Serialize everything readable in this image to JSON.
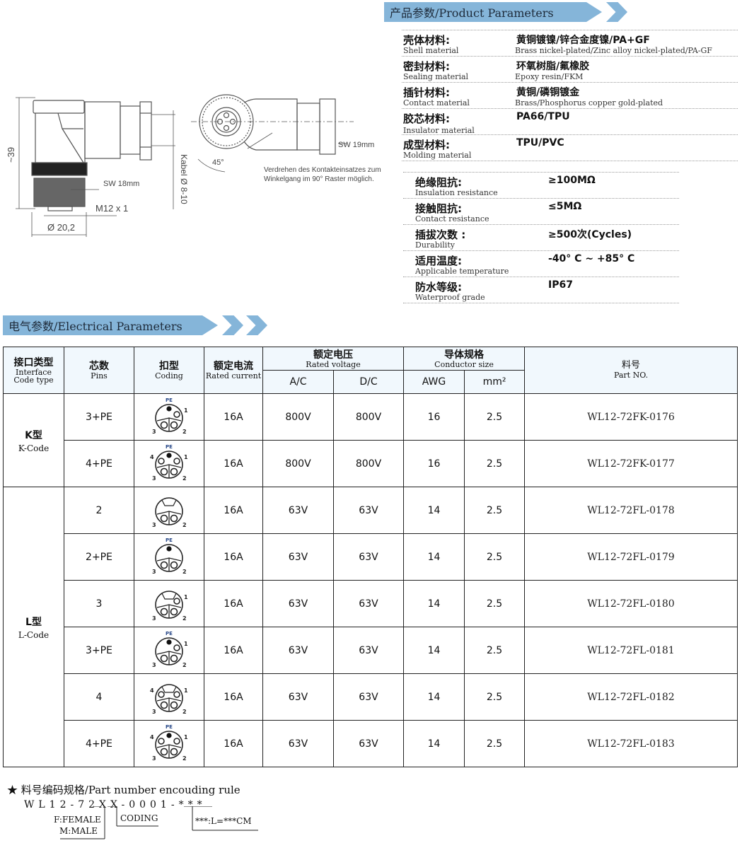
{
  "product_section": {
    "title": "产品参数/Product Parameters",
    "materials": [
      {
        "label_cn": "壳体材料:",
        "label_en": "Shell material",
        "value_cn": "黄铜镀镍/锌合金度镍/PA+GF",
        "value_en": "Brass nickel-plated/Zinc alloy nickel-plated/PA-GF"
      },
      {
        "label_cn": "密封材料:",
        "label_en": "Sealing material",
        "value_cn": "环氧树脂/氟橡胶",
        "value_en": "Epoxy resin/FKM"
      },
      {
        "label_cn": "插针材料:",
        "label_en": "Contact material",
        "value_cn": "黄铜/磷铜镀金",
        "value_en": "Brass/Phosphorus copper gold-plated"
      },
      {
        "label_cn": "胶芯材料:",
        "label_en": "Insulator material",
        "value_cn": "PA66/TPU",
        "value_en": ""
      },
      {
        "label_cn": "成型材料:",
        "label_en": "Molding material",
        "value_cn": "TPU/PVC",
        "value_en": ""
      }
    ],
    "specs": [
      {
        "label_cn": "绝缘阻抗:",
        "label_en": "Insulation resistance",
        "value": "≥100MΩ"
      },
      {
        "label_cn": "接触阻抗:",
        "label_en": "Contact resistance",
        "value": "≤5MΩ"
      },
      {
        "label_cn": "插拔次数 :",
        "label_en": "Durability",
        "value": "≥500次(Cycles)"
      },
      {
        "label_cn": "适用温度:",
        "label_en": "Applicable temperature",
        "value": "-40° C ~ +85° C"
      },
      {
        "label_cn": "防水等级:",
        "label_en": "Waterproof grade",
        "value": "IP67"
      }
    ]
  },
  "drawing": {
    "dim_height": "~39",
    "sw_18": "SW 18mm",
    "thread": "M12 x 1",
    "diameter": "Ø 20,2",
    "cable": "Kabel Ø 8-10",
    "angle": "45°",
    "sw_19": "SW 19mm",
    "note_line1": "Verdrehen des Kontakteinsatzes zum",
    "note_line2": "Winkelgang im 90° Raster möglich."
  },
  "electrical_section": {
    "title": "电气参数/Electrical Parameters",
    "headers": {
      "interface_cn": "接口类型",
      "interface_en1": "Interface",
      "interface_en2": "Code  type",
      "pins_cn": "芯数",
      "pins_en": "Pins",
      "coding_cn": "扣型",
      "coding_en": "Coding",
      "current_cn": "额定电流",
      "current_en": "Rated current",
      "voltage_cn": "额定电压",
      "voltage_en": "Rated voltage",
      "ac": "A/C",
      "dc": "D/C",
      "conductor_cn": "导体规格",
      "conductor_en": "Conductor size",
      "awg": "AWG",
      "mm2": "mm²",
      "part_cn": "料号",
      "part_en": "Part NO."
    },
    "groups": [
      {
        "name_cn": "K型",
        "name_en": "K-Code",
        "rows": [
          {
            "pins": "3+PE",
            "coding": "k-3pe",
            "current": "16A",
            "ac": "800V",
            "dc": "800V",
            "awg": "16",
            "mm2": "2.5",
            "part": "WL12-72FK-0176"
          },
          {
            "pins": "4+PE",
            "coding": "k-4pe",
            "current": "16A",
            "ac": "800V",
            "dc": "800V",
            "awg": "16",
            "mm2": "2.5",
            "part": "WL12-72FK-0177"
          }
        ]
      },
      {
        "name_cn": "L型",
        "name_en": "L-Code",
        "rows": [
          {
            "pins": "2",
            "coding": "l-2",
            "current": "16A",
            "ac": "63V",
            "dc": "63V",
            "awg": "14",
            "mm2": "2.5",
            "part": "WL12-72FL-0178"
          },
          {
            "pins": "2+PE",
            "coding": "l-2pe",
            "current": "16A",
            "ac": "63V",
            "dc": "63V",
            "awg": "14",
            "mm2": "2.5",
            "part": "WL12-72FL-0179"
          },
          {
            "pins": "3",
            "coding": "l-3",
            "current": "16A",
            "ac": "63V",
            "dc": "63V",
            "awg": "14",
            "mm2": "2.5",
            "part": "WL12-72FL-0180"
          },
          {
            "pins": "3+PE",
            "coding": "l-3pe",
            "current": "16A",
            "ac": "63V",
            "dc": "63V",
            "awg": "14",
            "mm2": "2.5",
            "part": "WL12-72FL-0181"
          },
          {
            "pins": "4",
            "coding": "l-4",
            "current": "16A",
            "ac": "63V",
            "dc": "63V",
            "awg": "14",
            "mm2": "2.5",
            "part": "WL12-72FL-0182"
          },
          {
            "pins": "4+PE",
            "coding": "l-4pe",
            "current": "16A",
            "ac": "63V",
            "dc": "63V",
            "awg": "14",
            "mm2": "2.5",
            "part": "WL12-72FL-0183"
          }
        ]
      }
    ],
    "pin_labels": {
      "pe": "PE",
      "p1": "1",
      "p2": "2",
      "p3": "3",
      "p4": "4"
    }
  },
  "encoding_rule": {
    "title": "★ 料号编码规格/Part number encouding rule",
    "code": "WL12-72XX-0001-***",
    "gender_f": "F:FEMALE",
    "gender_m": "M:MALE",
    "coding": "CODING",
    "length": "***:L=***CM"
  },
  "colors": {
    "banner": "#85b5d9",
    "header_bg": "#f1f8fd",
    "pin_label": "#c77a1c",
    "pe_label": "#2a4a8a"
  }
}
